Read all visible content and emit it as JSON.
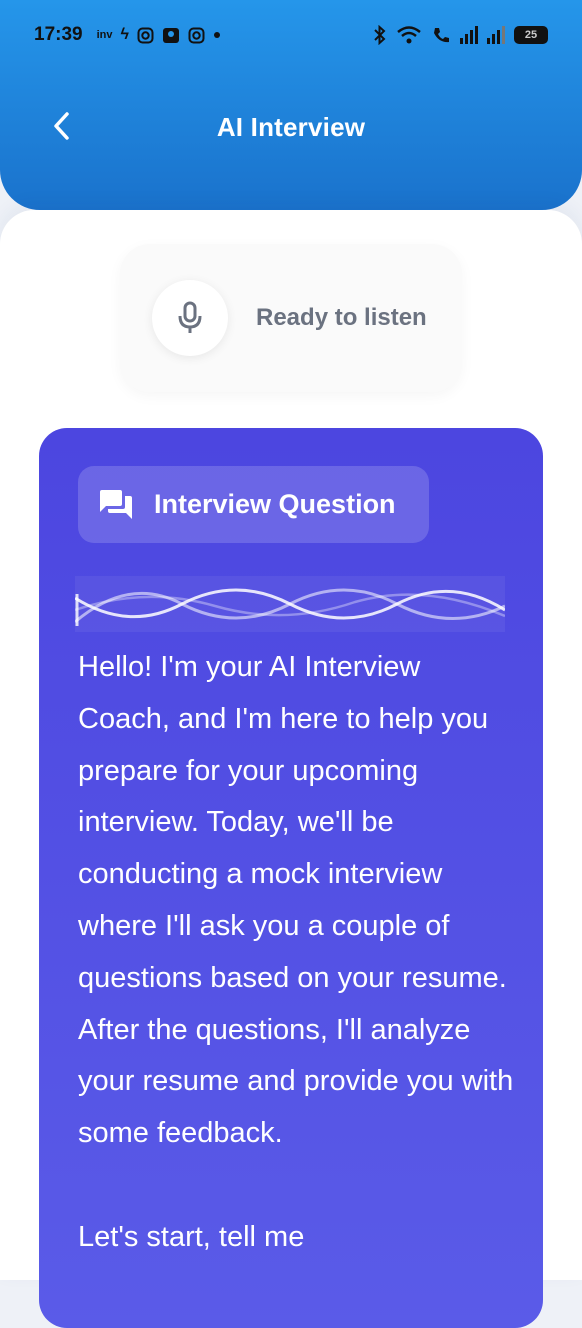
{
  "status_bar": {
    "time": "17:39",
    "left_icons": [
      "inv-icon",
      "flash-icon",
      "instagram-icon",
      "contacts-icon",
      "instagram-icon",
      "dot-icon"
    ],
    "battery": "25"
  },
  "header": {
    "title": "AI Interview"
  },
  "listen": {
    "status": "Ready to listen"
  },
  "question": {
    "chip_label": "Interview Question",
    "text": "Hello! I'm your AI Interview Coach, and I'm here to help you prepare for your upcoming interview. Today, we'll be conducting a mock interview where I'll ask you a couple of questions based on your resume. After the questions, I'll analyze your resume and provide you with some feedback.\n\nLet's start, tell me"
  },
  "colors": {
    "header_top": "#2596ea",
    "header_bottom": "#1a72cc",
    "card_accent": "#4c46e0"
  }
}
